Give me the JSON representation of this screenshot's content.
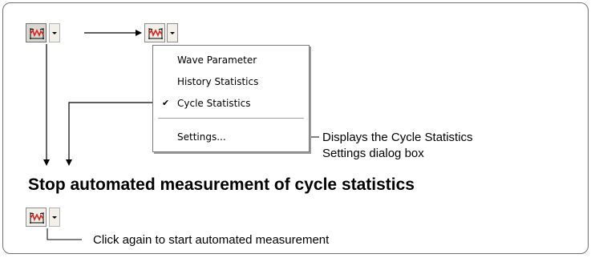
{
  "menu": {
    "items": [
      {
        "label": "Wave Parameter",
        "checked": false
      },
      {
        "label": "History Statistics",
        "checked": false
      },
      {
        "label": "Cycle Statistics",
        "checked": true
      },
      {
        "label": "Settings...",
        "checked": false
      }
    ],
    "check_glyph": "✔"
  },
  "callouts": {
    "settings_line1": "Displays the Cycle Statistics",
    "settings_line2": "Settings dialog box",
    "restart": "Click again to start automated measurement"
  },
  "heading": "Stop automated measurement of cycle statistics",
  "icons": {
    "measurement": "waveform-measurement-icon",
    "dropdown": "dropdown-arrow-icon"
  },
  "colors": {
    "waveform": "#dd2222",
    "frame": "#6e6e6e"
  }
}
